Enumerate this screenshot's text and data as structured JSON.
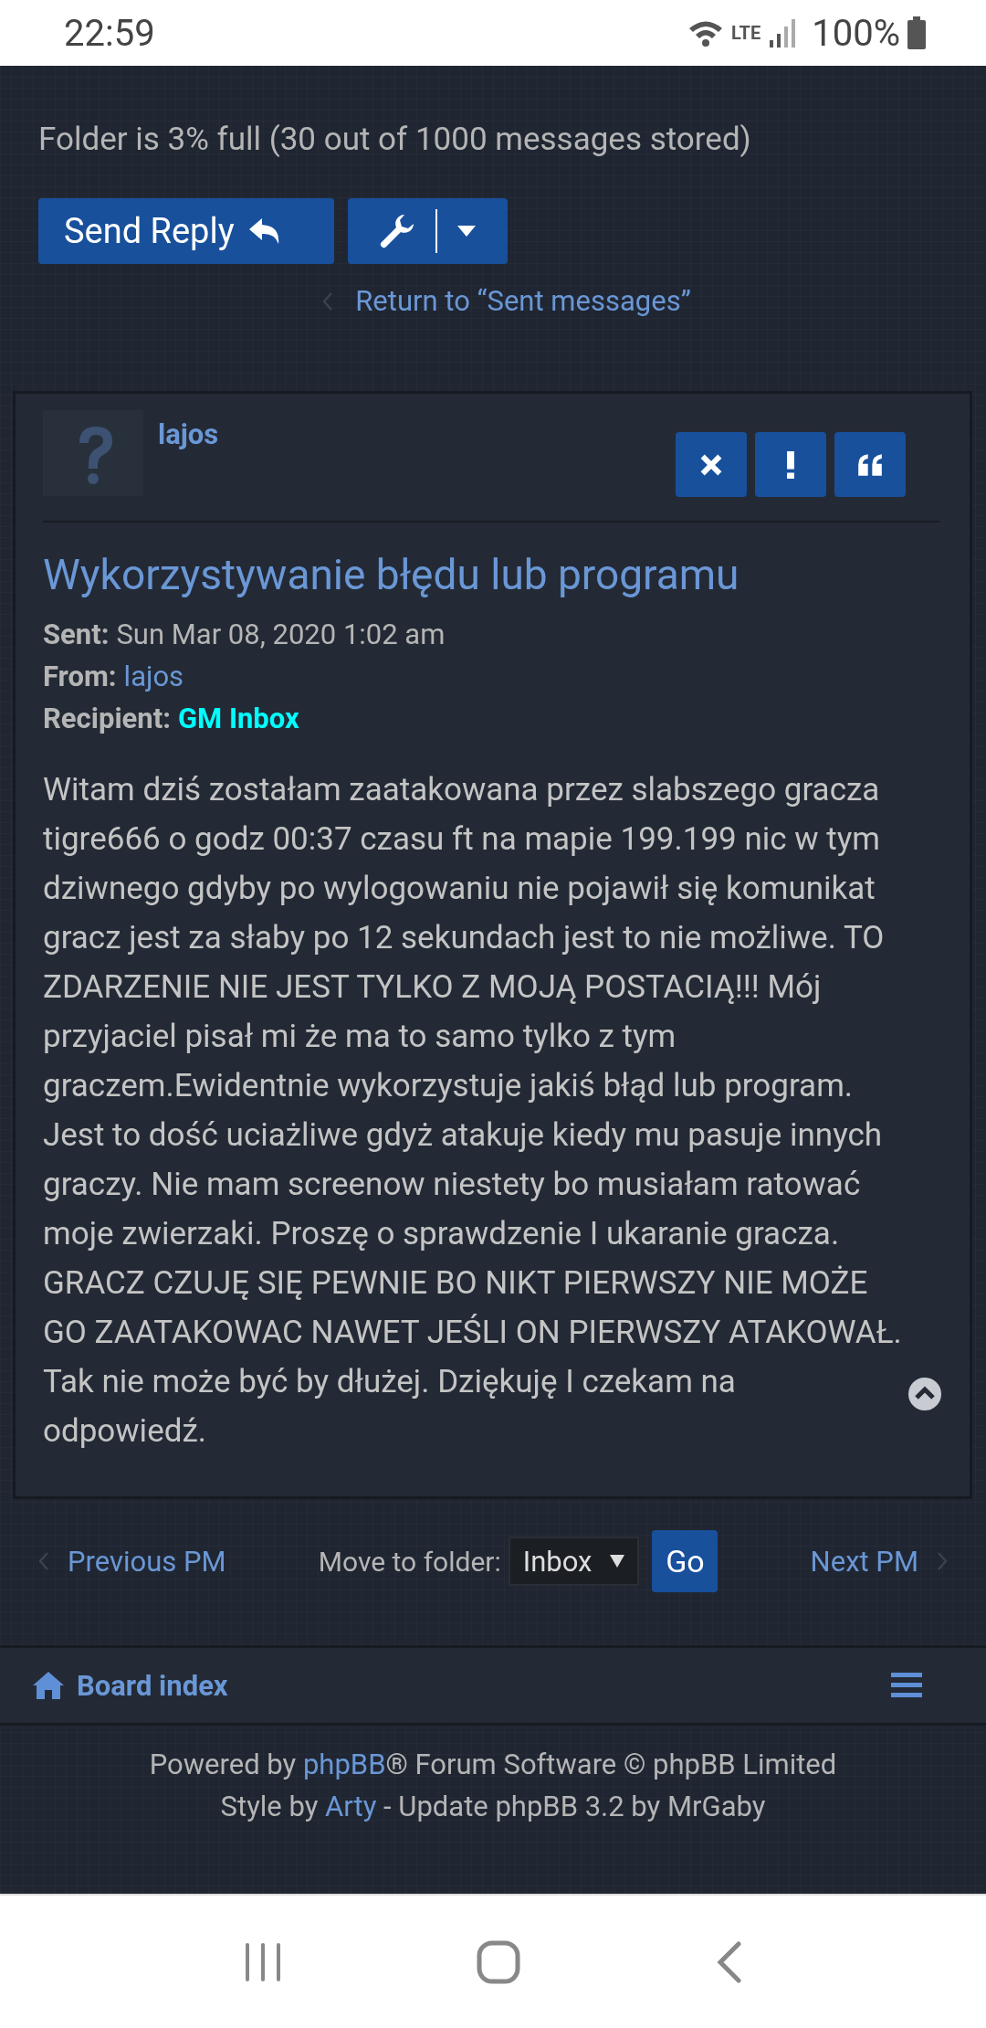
{
  "status_bar": {
    "time": "22:59",
    "network": "LTE",
    "battery": "100%"
  },
  "folder_status": "Folder is 3% full (30 out of 1000 messages stored)",
  "toolbar": {
    "reply_button": "Send Reply"
  },
  "return_link": "Return to “Sent messages”",
  "message": {
    "author": "lajos",
    "subject": "Wykorzystywanie błędu lub programu",
    "meta": [
      {
        "label": "Sent:",
        "value": "Sun Mar 08, 2020 1:02 am",
        "kind": "text"
      },
      {
        "label": "From:",
        "value": "lajos",
        "kind": "link"
      },
      {
        "label": "Recipient:",
        "value": "GM Inbox",
        "kind": "group"
      }
    ],
    "body": "Witam dziś zostałam zaatakowana przez slabszego gracza tigre666 o godz 00:37 czasu ft na mapie 199.199 nic w tym dziwnego gdyby po wylogowaniu nie pojawił się komunikat gracz jest za słaby po 12 sekundach jest to nie możliwe. TO ZDARZENIE NIE JEST TYLKO Z MOJĄ POSTACIĄ!!! Mój przyjaciel pisał mi że ma to samo tylko z tym graczem.Ewidentnie wykorzystuje jakiś błąd lub program. Jest to dość uciażliwe gdyż atakuje kiedy mu pasuje innych graczy. Nie mam screenow niestety bo musiałam ratować moje zwierzaki. Proszę o sprawdzenie I ukaranie gracza. GRACZ CZUJĘ SIĘ PEWNIE BO NIKT PIERWSZY NIE MOŻE GO ZAATAKOWAC NAWET JEŚLI ON PIERWSZY ATAKOWAŁ. Tak nie może być by dłużej. Dziękuję I czekam na odpowiedź."
  },
  "pm_nav": {
    "previous": "Previous PM",
    "move_label": "Move to folder:",
    "folder": "Inbox",
    "go": "Go",
    "next": "Next PM"
  },
  "navbar": {
    "board_index": "Board index"
  },
  "footer": [
    [
      {
        "text": "Powered by ",
        "kind": "text"
      },
      {
        "text": "phpBB",
        "kind": "link"
      },
      {
        "text": "® Forum Software © phpBB Limited",
        "kind": "text"
      }
    ],
    [
      {
        "text": "Style by ",
        "kind": "text"
      },
      {
        "text": "Arty",
        "kind": "link"
      },
      {
        "text": " - Update phpBB 3.2 by MrGaby",
        "kind": "text"
      }
    ]
  ]
}
